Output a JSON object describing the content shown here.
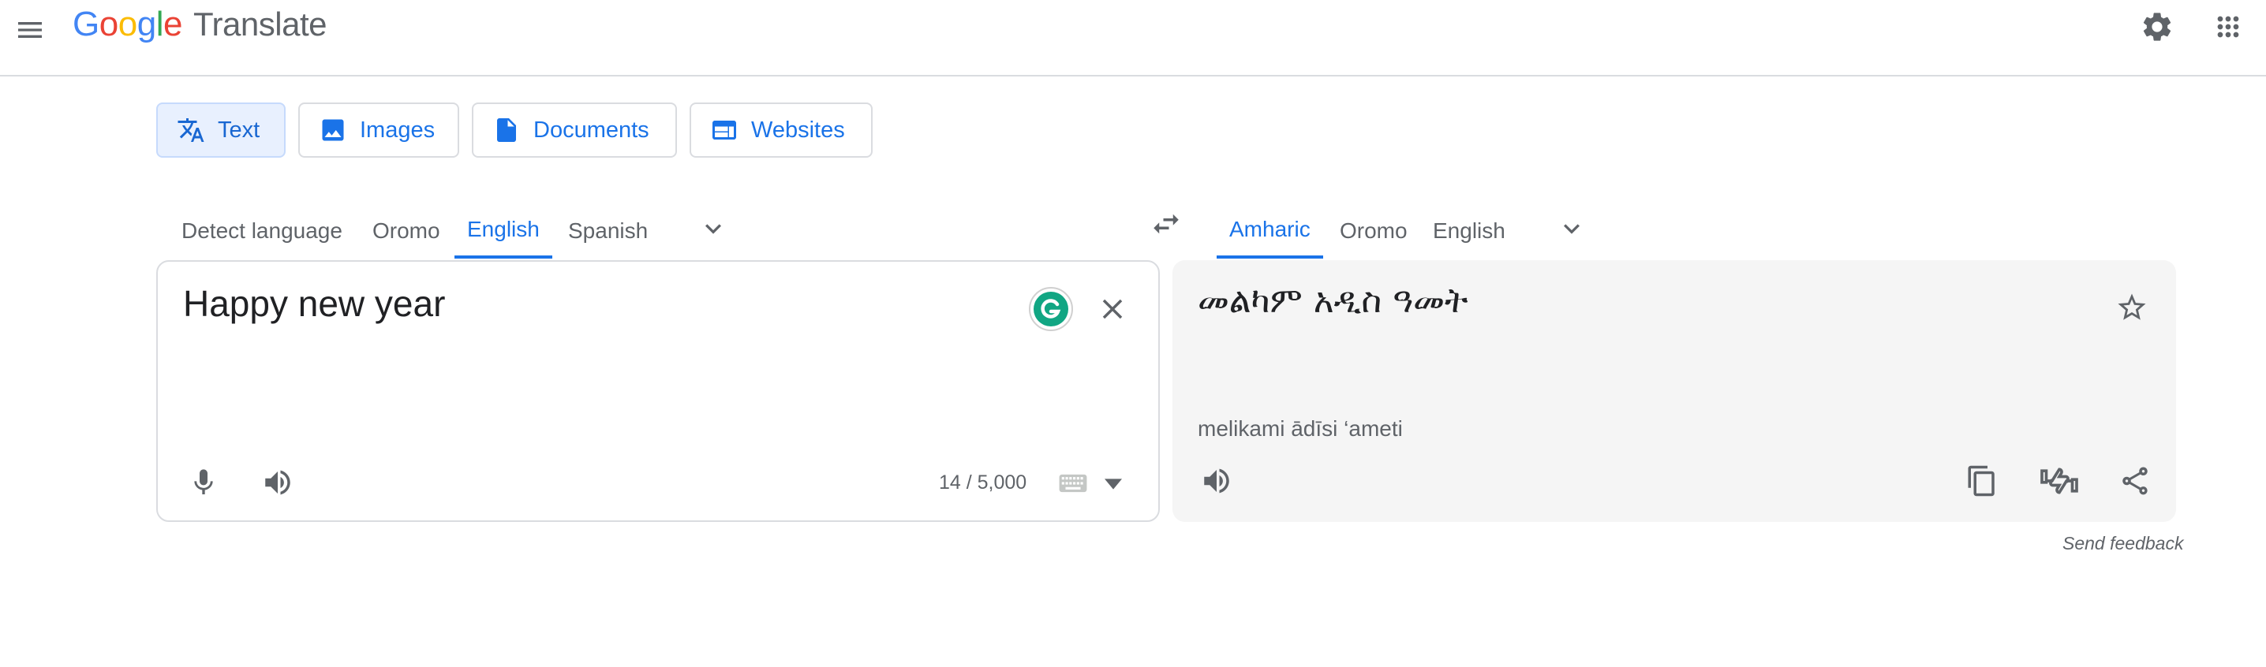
{
  "header": {
    "logo_google": [
      "G",
      "o",
      "o",
      "g",
      "l",
      "e"
    ],
    "logo_product": "Translate",
    "icons": [
      "menu-icon",
      "settings-icon",
      "apps-icon"
    ]
  },
  "modes": [
    {
      "label": "Text",
      "icon": "translate-icon",
      "active": true
    },
    {
      "label": "Images",
      "icon": "image-icon",
      "active": false
    },
    {
      "label": "Documents",
      "icon": "document-icon",
      "active": false
    },
    {
      "label": "Websites",
      "icon": "website-icon",
      "active": false
    }
  ],
  "source_langs": [
    {
      "label": "Detect language",
      "active": false
    },
    {
      "label": "Oromo",
      "active": false
    },
    {
      "label": "English",
      "active": true
    },
    {
      "label": "Spanish",
      "active": false
    }
  ],
  "target_langs": [
    {
      "label": "Amharic",
      "active": true
    },
    {
      "label": "Oromo",
      "active": false
    },
    {
      "label": "English",
      "active": false
    }
  ],
  "source": {
    "text": "Happy new year",
    "char_count": "14 / 5,000"
  },
  "target": {
    "text": "መልካም አዲስ ዓመት",
    "transliteration": "melikami ādīsi ‘ameti"
  },
  "feedback_label": "Send feedback",
  "colors": {
    "accent": "#1a73e8",
    "active_tab_bg": "#e8f0fe",
    "target_bg": "#f5f5f5",
    "grammarly": "#15c39a"
  }
}
